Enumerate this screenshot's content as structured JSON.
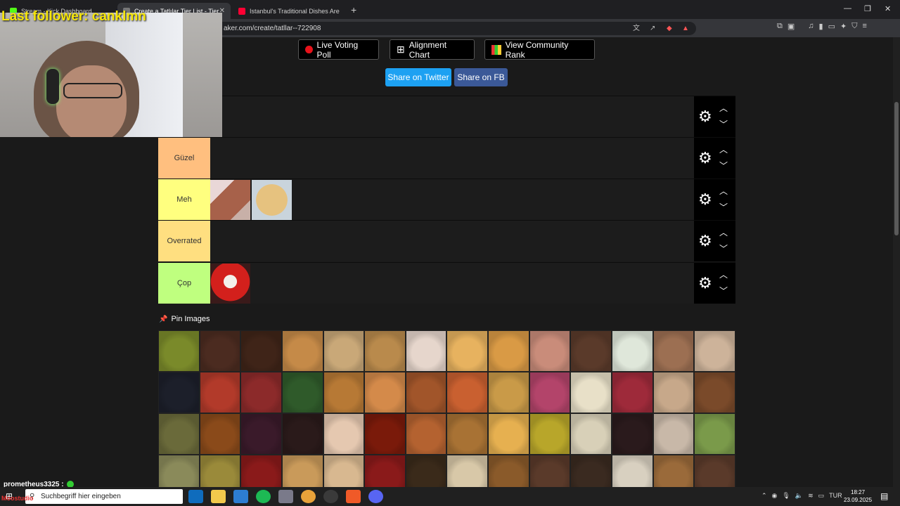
{
  "browser": {
    "tabs": [
      {
        "label": "Stream - Kick Dashboard",
        "color": "#53fc18"
      },
      {
        "label": "Create a Tatlılar Tier List - TierMaker",
        "color": "#888888"
      },
      {
        "label": "Istanbul's Traditional Dishes Are VEGAN",
        "color": "#ff0033"
      }
    ],
    "url": "aker.com/create/tatllar--722908"
  },
  "page": {
    "buttons": {
      "live_poll": "Live Voting Poll",
      "alignment": "Alignment Chart",
      "community": "View Community Rank"
    },
    "share": {
      "twitter": "Share on Twitter",
      "fb": "Share on FB"
    },
    "tiers": [
      {
        "label": "",
        "color": "#1c1c1c",
        "items": []
      },
      {
        "label": "Güzel",
        "color": "#ffbf7f",
        "items": []
      },
      {
        "label": "Meh",
        "color": "#ffff7f",
        "items": [
          "#a7614a",
          "#d9b27a"
        ]
      },
      {
        "label": "Overrated",
        "color": "#ffdf80",
        "items": []
      },
      {
        "label": "Çop",
        "color": "#bfff7f",
        "items": [
          "#c51818"
        ]
      }
    ],
    "pin_label": "Pin Images",
    "pool_colors": [
      "#7a8a2a",
      "#4b2b20",
      "#3f2418",
      "#c58a48",
      "#c9a878",
      "#b98a4c",
      "#e6d6cc",
      "#e7b25f",
      "#d99a45",
      "#c98c7a",
      "#5a3a2a",
      "#dfe7da",
      "#9c6f52",
      "#cdb39a",
      "#1c1f2a",
      "#b23a2a",
      "#8c2a2a",
      "#2f5a2a",
      "#b77935",
      "#d48a4a",
      "#a1552a",
      "#c96030",
      "#c99a48",
      "#b3446a",
      "#e8e0c8",
      "#9e2a3a",
      "#c7a88a",
      "#7a4a2a",
      "#6a6a3a",
      "#8a4a1a",
      "#3a1a2a",
      "#2a1a1a",
      "#e5c8b0",
      "#7a1a0a",
      "#b46230",
      "#a87234",
      "#e6b050",
      "#b8a62a",
      "#d8d0b8",
      "#2a1a1c",
      "#c8b8a8",
      "#7a9a4a",
      "#8a8a5a",
      "#9a8a3a",
      "#8a1a1a",
      "#c99a5a",
      "#d8b890",
      "#8a1a1a",
      "#3a2a1a",
      "#d8c8a8",
      "#8a5a2a",
      "#5a3a2a",
      "#3a2a20",
      "#d8d0c0",
      "#9a6a3a",
      "#5a3a2a"
    ]
  },
  "overlay": {
    "follower": "Last follower: canklmn",
    "chat_user": "prometheus3325 :",
    "brand": "Moostudio"
  },
  "taskbar": {
    "search_placeholder": "Suchbegriff hier eingeben",
    "lang": "TUR",
    "time": "18:27",
    "date": "23.09.2025"
  }
}
